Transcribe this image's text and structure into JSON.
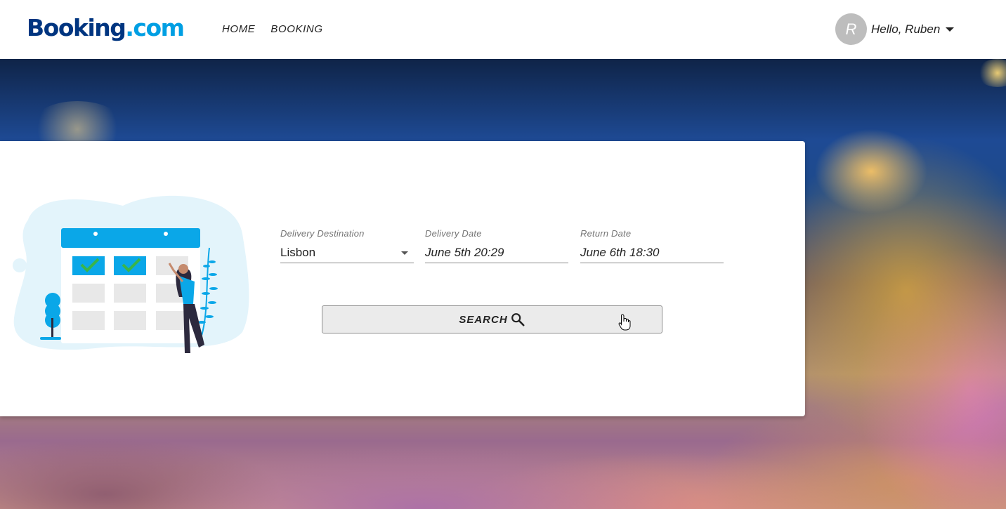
{
  "brand": {
    "part1": "Booking",
    "part2": ".com",
    "color_dark": "#003580",
    "color_light": "#009fe3"
  },
  "nav": {
    "items": [
      {
        "label": "HOME"
      },
      {
        "label": "BOOKING"
      }
    ]
  },
  "user": {
    "initial": "R",
    "greeting": "Hello, Ruben",
    "icon": "chevron-down-icon"
  },
  "search_form": {
    "destination": {
      "label": "Delivery Destination",
      "value": "Lisbon"
    },
    "delivery_date": {
      "label": "Delivery Date",
      "value": "June 5th 20:29"
    },
    "return_date": {
      "label": "Return Date",
      "value": "June 6th 18:30"
    },
    "search_button": {
      "label": "SEARCH",
      "icon": "search-icon"
    }
  },
  "colors": {
    "accent_blue": "#0aa7e8",
    "check_green": "#39b54a"
  }
}
